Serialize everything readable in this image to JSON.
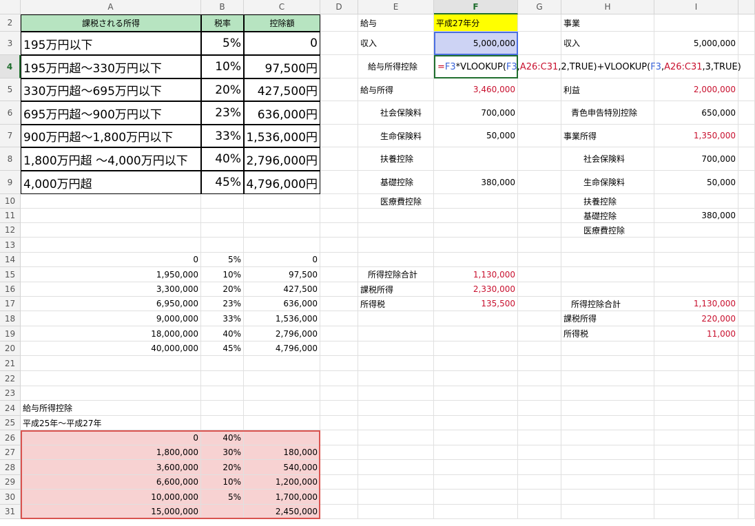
{
  "columns": [
    "A",
    "B",
    "C",
    "D",
    "E",
    "F",
    "G",
    "H",
    "I"
  ],
  "active_column": "F",
  "rows": [
    "2",
    "3",
    "4",
    "5",
    "6",
    "7",
    "8",
    "9",
    "10",
    "11",
    "12",
    "13",
    "14",
    "15",
    "16",
    "17",
    "18",
    "19",
    "20",
    "21",
    "22",
    "23",
    "24",
    "25",
    "26",
    "27",
    "28",
    "29",
    "30",
    "31"
  ],
  "active_row": "4",
  "tax_table": {
    "headers": [
      "課税される所得",
      "税率",
      "控除額"
    ],
    "rows": [
      [
        "195万円以下",
        "5%",
        "0"
      ],
      [
        "195万円超〜330万円以下",
        "10%",
        "97,500円"
      ],
      [
        "330万円超〜695万円以下",
        "20%",
        "427,500円"
      ],
      [
        "695万円超〜900万円以下",
        "23%",
        "636,000円"
      ],
      [
        "900万円超〜1,800万円以下",
        "33%",
        "1,536,000円"
      ],
      [
        "1,800万円超 〜4,000万円以下",
        "40%",
        "2,796,000円"
      ],
      [
        "4,000万円超",
        "45%",
        "4,796,000円"
      ]
    ]
  },
  "tax_lookup": [
    [
      "0",
      "5%",
      "0"
    ],
    [
      "1,950,000",
      "10%",
      "97,500"
    ],
    [
      "3,300,000",
      "20%",
      "427,500"
    ],
    [
      "6,950,000",
      "23%",
      "636,000"
    ],
    [
      "9,000,000",
      "33%",
      "1,536,000"
    ],
    [
      "18,000,000",
      "40%",
      "2,796,000"
    ],
    [
      "40,000,000",
      "45%",
      "4,796,000"
    ]
  ],
  "salary_deduction": {
    "title": "給与所得控除",
    "period": "平成25年〜平成27年",
    "rows": [
      [
        "0",
        "40%",
        ""
      ],
      [
        "1,800,000",
        "30%",
        "180,000"
      ],
      [
        "3,600,000",
        "20%",
        "540,000"
      ],
      [
        "6,600,000",
        "10%",
        "1,200,000"
      ],
      [
        "10,000,000",
        "5%",
        "1,700,000"
      ],
      [
        "15,000,000",
        "",
        "2,450,000"
      ]
    ]
  },
  "salary": {
    "label": "給与",
    "year": "平成27年分",
    "income_label": "収入",
    "income": "5,000,000",
    "deduction_label": "給与所得控除",
    "formula": {
      "eq": "=",
      "ref1": "F3",
      "t1": "*VLOOKUP(",
      "ref2": "F3",
      "t2": ",",
      "ref3": "A26:C31",
      "t3": ",2,TRUE)+VLOOKUP(",
      "ref4": "F3",
      "t4": ",",
      "ref5": "A26:C31",
      "t5": ",3,TRUE)"
    },
    "salary_income_label": "給与所得",
    "salary_income": "3,460,000",
    "items": [
      {
        "label": "社会保険料",
        "value": "700,000"
      },
      {
        "label": "生命保険料",
        "value": "50,000"
      },
      {
        "label": "扶養控除",
        "value": ""
      },
      {
        "label": "基礎控除",
        "value": "380,000"
      },
      {
        "label": "医療費控除",
        "value": ""
      }
    ],
    "total_label": "所得控除合計",
    "total": "1,130,000",
    "taxable_label": "課税所得",
    "taxable": "2,330,000",
    "tax_label": "所得税",
    "tax": "135,500"
  },
  "business": {
    "label": "事業",
    "income_label": "収入",
    "income": "5,000,000",
    "profit_label": "利益",
    "profit": "2,000,000",
    "blue_label": "青色申告特別控除",
    "blue": "650,000",
    "biz_income_label": "事業所得",
    "biz_income": "1,350,000",
    "items": [
      {
        "label": "社会保険料",
        "value": "700,000"
      },
      {
        "label": "生命保険料",
        "value": "50,000"
      },
      {
        "label": "扶養控除",
        "value": ""
      },
      {
        "label": "基礎控除",
        "value": "380,000"
      },
      {
        "label": "医療費控除",
        "value": ""
      }
    ],
    "total_label": "所得控除合計",
    "total": "1,130,000",
    "taxable_label": "課税所得",
    "taxable": "220,000",
    "tax_label": "所得税",
    "tax": "11,000"
  },
  "colors": {
    "header_green": "#b7e4c1",
    "highlight_yellow": "#ffff00",
    "range_pink": "#f7d2d2",
    "selection_blue": "#cdd3f4",
    "accent_red": "#c8102e",
    "active_green": "#1f6e2e"
  }
}
